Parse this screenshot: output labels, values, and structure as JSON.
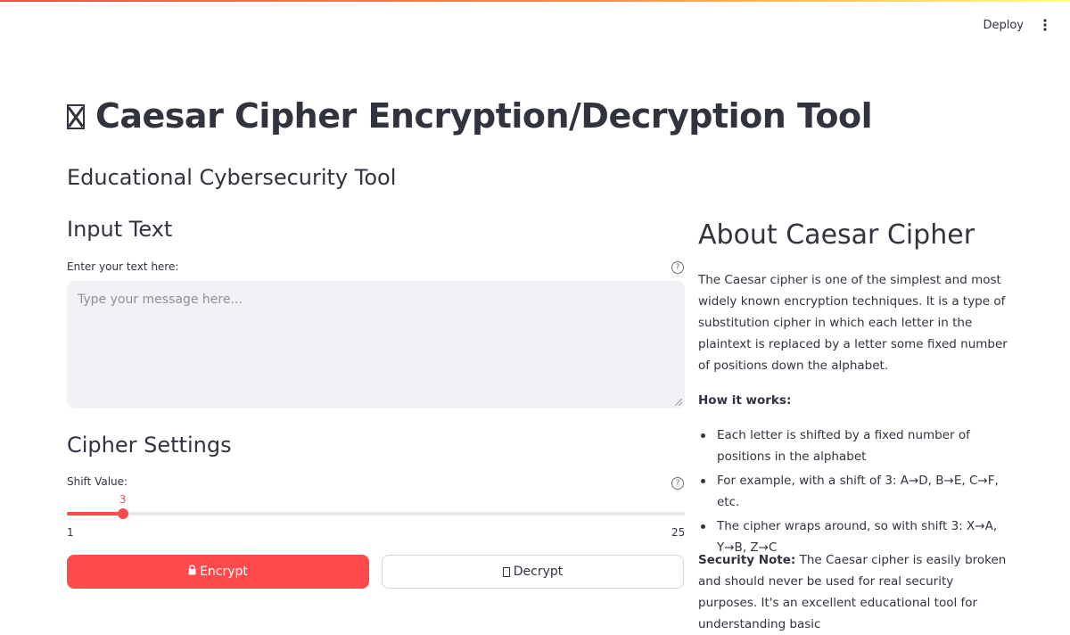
{
  "header": {
    "deploy_label": "Deploy",
    "menu_icon": "kebab-menu-icon"
  },
  "main": {
    "title": "Caesar Cipher Encryption/Decryption Tool",
    "subtitle": "Educational Cybersecurity Tool",
    "input_section": {
      "heading": "Input Text",
      "field_label": "Enter your text here:",
      "placeholder": "Type your message here...",
      "value": ""
    },
    "settings_section": {
      "heading": "Cipher Settings",
      "shift_label": "Shift Value:",
      "shift_value": "3",
      "shift_min": "1",
      "shift_max": "25"
    },
    "buttons": {
      "encrypt_label": "Encrypt",
      "decrypt_label": "Decrypt"
    }
  },
  "about": {
    "heading": "About Caesar Cipher",
    "intro": "The Caesar cipher is one of the simplest and most widely known encryption techniques. It is a type of substitution cipher in which each letter in the plaintext is replaced by a letter some fixed number of positions down the alphabet.",
    "how_heading": "How it works:",
    "bullets": [
      "Each letter is shifted by a fixed number of positions in the alphabet",
      "For example, with a shift of 3: A→D, B→E, C→F, etc.",
      "The cipher wraps around, so with shift 3: X→A, Y→B, Z→C"
    ],
    "security_label": "Security Note:",
    "security_text": " The Caesar cipher is easily broken and should never be used for real security purposes. It's an excellent educational tool for understanding basic"
  },
  "colors": {
    "accent": "#ff4b4b",
    "text": "#31333f",
    "input_bg": "#f0f2f6"
  }
}
